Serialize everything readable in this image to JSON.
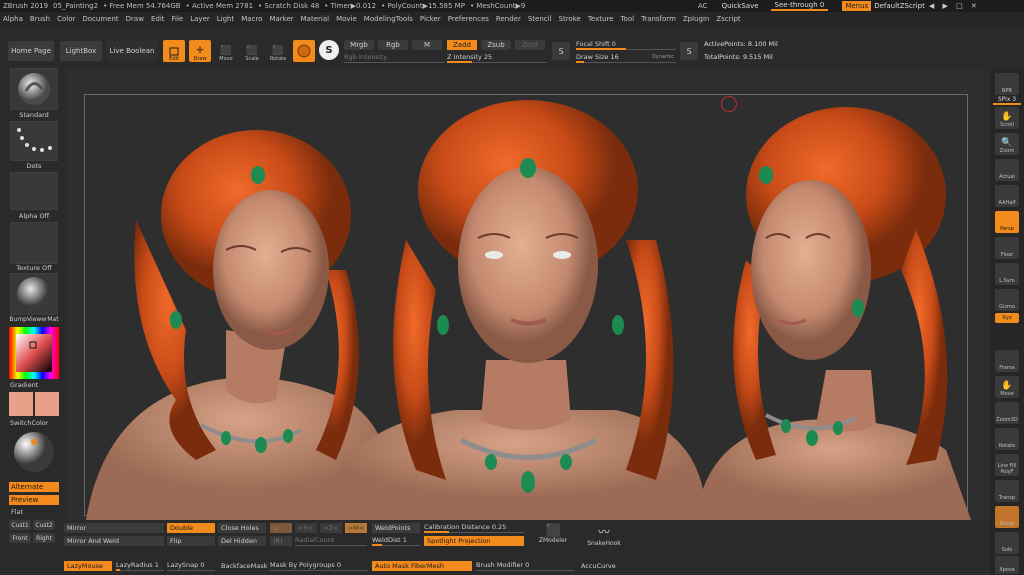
{
  "titlebar": {
    "items": [
      "ZBrush 2019",
      "05_Painting2",
      "• Free Mem 54.764GB",
      "• Active Mem 2781",
      "• Scratch Disk 48",
      "• Timer▶0.012",
      "• PolyCount▶15.585 MP",
      "• MeshCount▶9"
    ],
    "ac": "AC",
    "quicksave": "QuickSave",
    "seethrough": "See-through  0",
    "menus": "Menus",
    "defaultzscript": "DefaultZScript"
  },
  "menubar": [
    "Alpha",
    "Brush",
    "Color",
    "Document",
    "Draw",
    "Edit",
    "File",
    "Layer",
    "Light",
    "Macro",
    "Marker",
    "Material",
    "Movie",
    "ModelingTools",
    "Picker",
    "Preferences",
    "Render",
    "Stencil",
    "Stroke",
    "Texture",
    "Tool",
    "Transform",
    "Zplugin",
    "Zscript"
  ],
  "shelf": {
    "home": "Home Page",
    "lightbox": "LightBox",
    "liveboolean": "Live Boolean",
    "edit": "Edit",
    "draw": "Draw",
    "move": "Move",
    "scale": "Scale",
    "rotate": "Rotate",
    "mrgb": "Mrgb",
    "rgb": "Rgb",
    "m": "M",
    "rgb_intensity": "Rgb Intensity",
    "zadd": "Zadd",
    "zsub": "Zsub",
    "zcut": "Zcut",
    "z_intensity": "Z Intensity 25",
    "focal_shift": "Focal Shift 0",
    "draw_size": "Draw Size 16",
    "dynamic": "Dynamic",
    "active_points": "ActivePoints: 8.100 Mil",
    "total_points": "TotalPoints: 9.515 Mil"
  },
  "left": {
    "standard": "Standard",
    "dots": "Dots",
    "alpha": "Alpha Off",
    "texture": "Texture Off",
    "material": "BumpViewerMat",
    "gradient": "Gradient",
    "switchcolor": "SwitchColor",
    "alternate": "Alternate",
    "preview": "Preview",
    "flat": "Flat",
    "cust1": "Cust1",
    "cust2": "Cust2",
    "front": "Front",
    "right": "Right"
  },
  "right": {
    "bpr": "BPR",
    "spix": "SPix 3",
    "scroll": "Scroll",
    "zoom": "Zoom",
    "actual": "Actual",
    "aahalf": "AAHalf",
    "persp": "Persp",
    "floor": "Floor",
    "local": "L.Sym",
    "gizmo": "Gizmo",
    "xyz": "Xyz",
    "frame": "Frame",
    "move": "Move",
    "zoom3d": "Zoom3D",
    "rotate": "Rotate",
    "linefill": "Line Fill",
    "polyf": "PolyF",
    "transp": "Transp",
    "ghost": "Ghost",
    "solo": "Solo",
    "xpose": "Xpose"
  },
  "bottom": {
    "mirror": "Mirror",
    "mirrorweld": "Mirror And Weld",
    "double": "Double",
    "flip": "Flip",
    "closeholes": "Close Holes",
    "delhidden": "Del Hidden",
    "x": "x",
    "y": ">Y<",
    "z": ">Z<",
    "m": ">M<",
    "r": "(R)",
    "radialcount": "RadialCount",
    "weldpoints": "WeldPoints",
    "welddist": "WeldDist 1",
    "calibration": "Calibration Distance 0.25",
    "spotlight": "Spotlight Projection",
    "zmodeler": "ZModeler",
    "snakehook": "SnakeHook",
    "lazymouse": "LazyMouse",
    "lazyradius": "LazyRadius 1",
    "lazysnap": "LazySnap 0",
    "backfacemask": "BackfaceMask",
    "maskbypolygroups": "Mask By Polygroups 0",
    "automask": "Auto Mask FiberMesh",
    "brushmodifier": "Brush Modifier 0",
    "accucurve": "AccuCurve"
  },
  "colors": {
    "accent": "#f28a1c",
    "primary_color": "#e8a08a",
    "secondary_color": "#e8a08a",
    "hair": "#d9531e",
    "skin": "#c98f75"
  }
}
